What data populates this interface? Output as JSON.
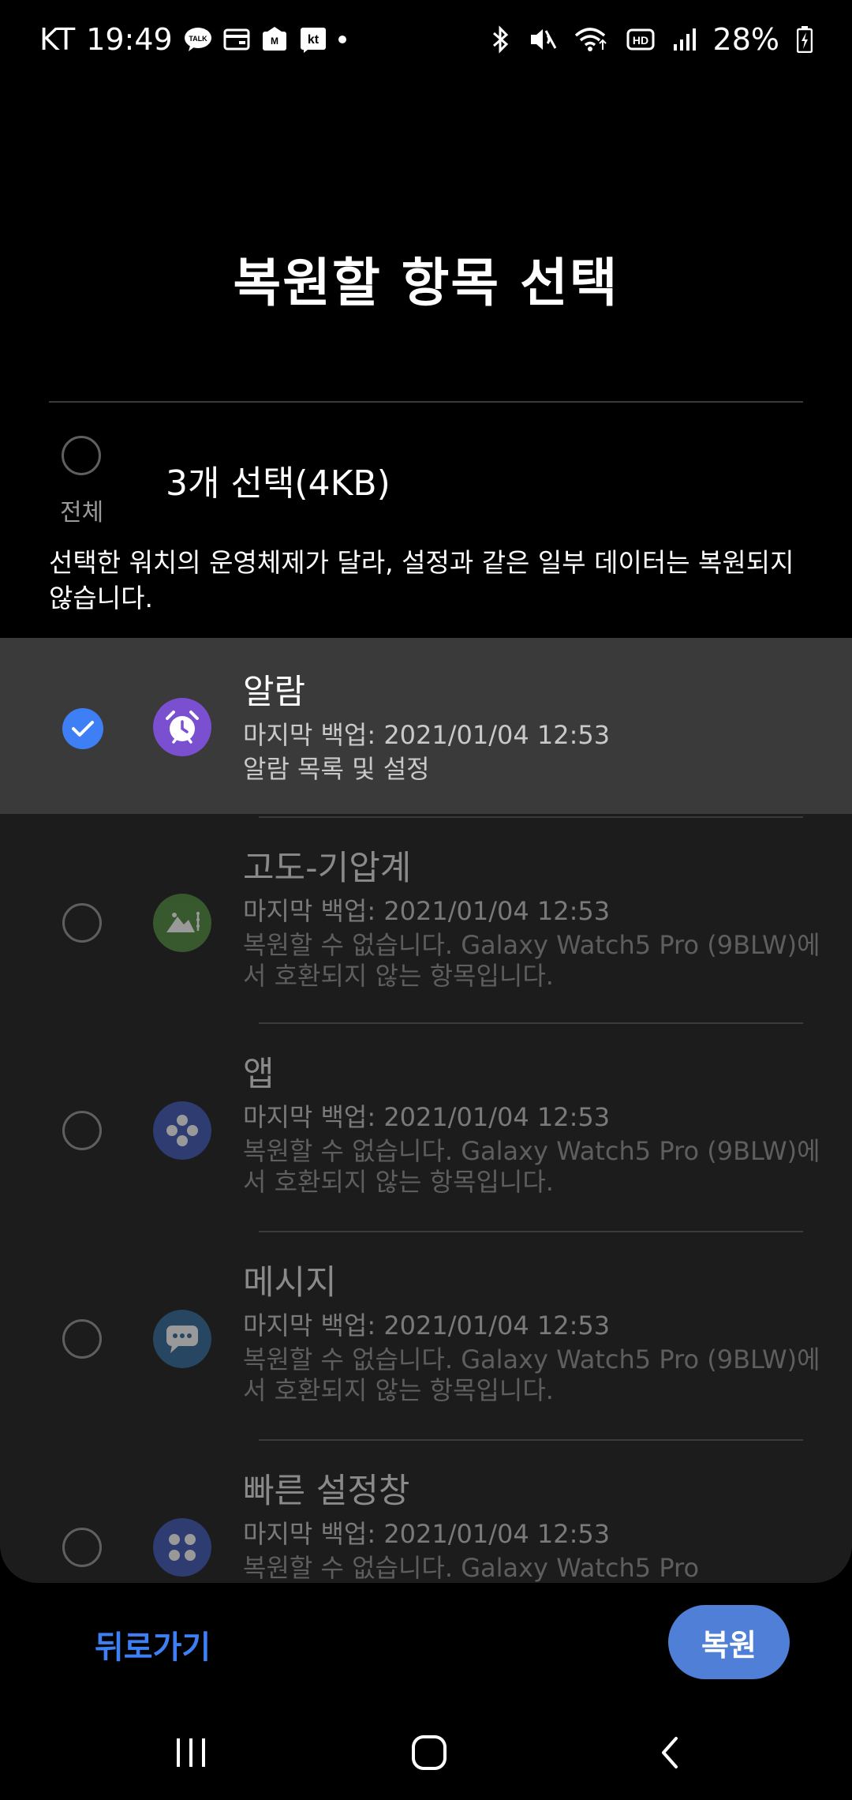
{
  "status_bar": {
    "carrier": "KT",
    "time": "19:49",
    "battery": "28%",
    "left_icons": [
      "talk-icon",
      "wallet-icon",
      "mail-icon",
      "kt-icon"
    ],
    "right_icons": [
      "bluetooth-icon",
      "mute-icon",
      "wifi-icon",
      "hd-icon",
      "signal-icon",
      "battery-icon"
    ]
  },
  "page": {
    "title": "복원할 항목 선택"
  },
  "select_all": {
    "label": "전체",
    "summary": "3개 선택(4KB)"
  },
  "notice": "선택한 워치의 운영체제가 달라, 설정과 같은 일부 데이터는 복원되지 않습니다.",
  "items": [
    {
      "name": "알람",
      "last_backup": "마지막 백업: 2021/01/04 12:53",
      "desc": "알람 목록 및 설정",
      "checked": true,
      "icon": "alarm-icon",
      "icon_color": "#7a4fd0"
    },
    {
      "name": "고도-기압계",
      "last_backup": "마지막 백업: 2021/01/04 12:53",
      "desc": "복원할 수 없습니다. Galaxy Watch5 Pro (9BLW)에서 호환되지 않는 항목입니다.",
      "checked": false,
      "icon": "barometer-icon",
      "icon_color": "#4f8a3c"
    },
    {
      "name": "앱",
      "last_backup": "마지막 백업: 2021/01/04 12:53",
      "desc": "복원할 수 없습니다. Galaxy Watch5 Pro (9BLW)에서 호환되지 않는 항목입니다.",
      "checked": false,
      "icon": "apps-icon",
      "icon_color": "#3d57b8"
    },
    {
      "name": "메시지",
      "last_backup": "마지막 백업: 2021/01/04 12:53",
      "desc": "복원할 수 없습니다. Galaxy Watch5 Pro (9BLW)에서 호환되지 않는 항목입니다.",
      "checked": false,
      "icon": "message-icon",
      "icon_color": "#2f6a9a"
    },
    {
      "name": "빠른 설정창",
      "last_backup": "마지막 백업: 2021/01/04 12:53",
      "desc": "복원할 수 없습니다. Galaxy Watch5 Pro",
      "checked": false,
      "icon": "quick-settings-icon",
      "icon_color": "#3d57b8"
    }
  ],
  "actions": {
    "back_label": "뒤로가기",
    "restore_label": "복원"
  },
  "colors": {
    "accent": "#3e7ff5",
    "background": "#000000",
    "card": "#1c1c1c"
  }
}
